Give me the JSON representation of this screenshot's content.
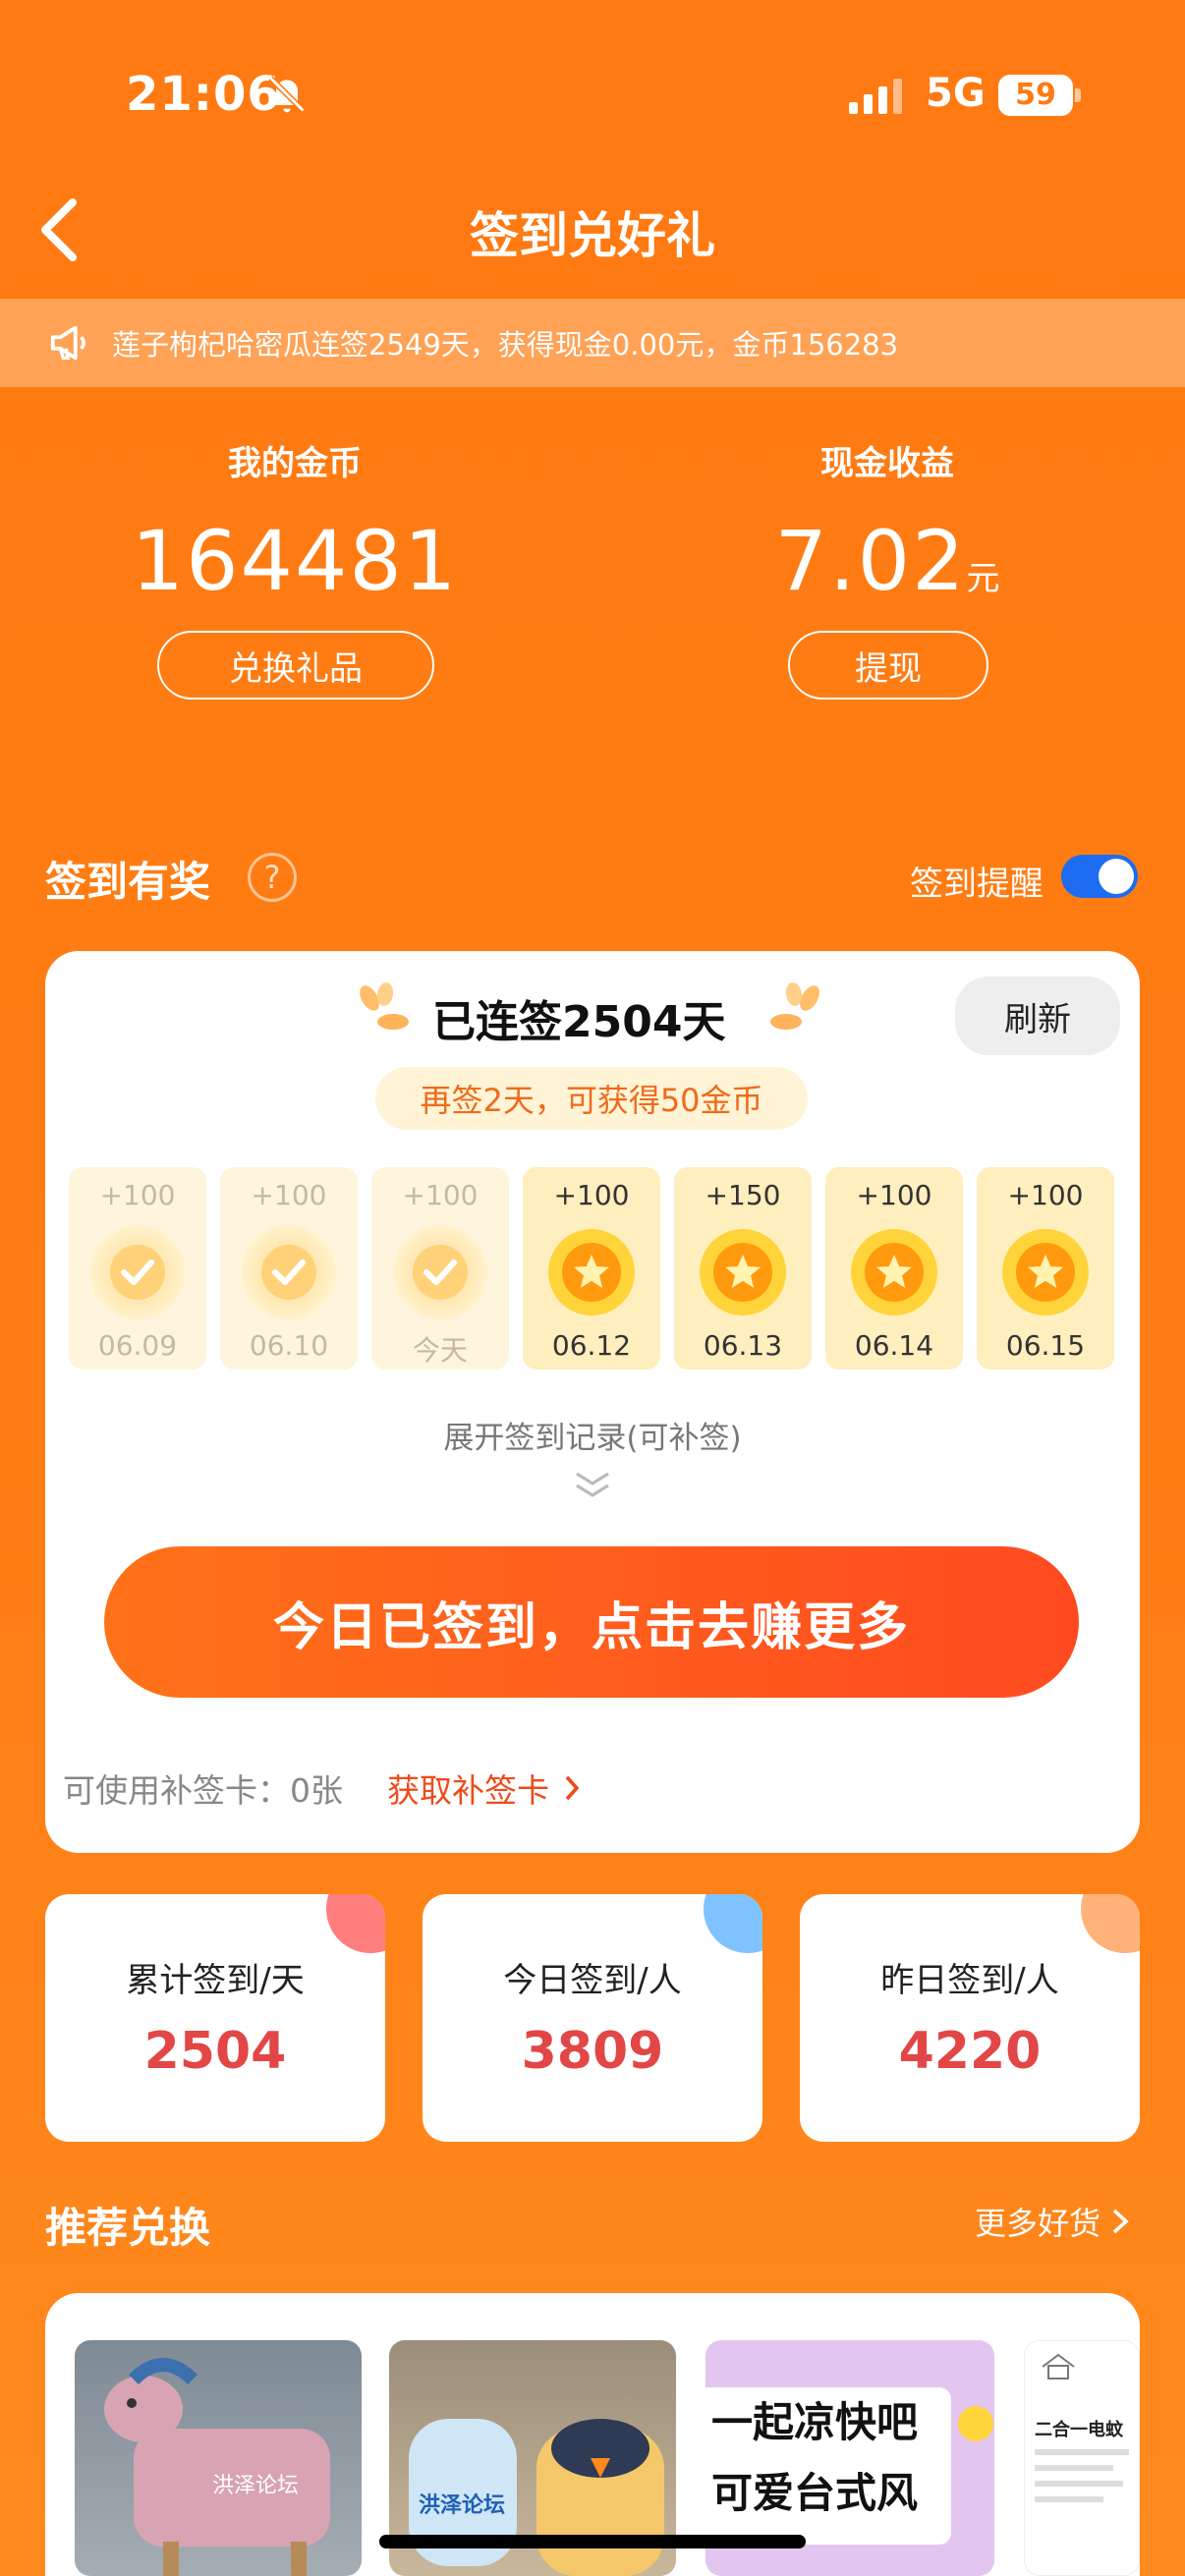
{
  "status_bar": {
    "time": "21:06",
    "network": "5G",
    "battery": "59"
  },
  "header": {
    "title": "签到兑好礼"
  },
  "notice": {
    "text": "莲子枸杞哈密瓜连签2549天，获得现金0.00元，金币156283"
  },
  "wallet": {
    "coins_label": "我的金币",
    "coins_value": "164481",
    "coins_button": "兑换礼品",
    "cash_label": "现金收益",
    "cash_value": "7.02",
    "cash_unit": "元",
    "cash_button": "提现"
  },
  "checkin_section": {
    "title": "签到有奖",
    "help": "?",
    "reminder_label": "签到提醒",
    "reminder_on": true
  },
  "checkin_card": {
    "streak": "已连签2504天",
    "refresh": "刷新",
    "hint": "再签2天，可获得50金币",
    "days": [
      {
        "points": "+100",
        "date": "06.09",
        "state": "done"
      },
      {
        "points": "+100",
        "date": "06.10",
        "state": "done"
      },
      {
        "points": "+100",
        "date": "今天",
        "state": "done"
      },
      {
        "points": "+100",
        "date": "06.12",
        "state": "upcoming"
      },
      {
        "points": "+150",
        "date": "06.13",
        "state": "upcoming"
      },
      {
        "points": "+100",
        "date": "06.14",
        "state": "upcoming"
      },
      {
        "points": "+100",
        "date": "06.15",
        "state": "upcoming"
      }
    ],
    "expand": "展开签到记录(可补签)",
    "cta": "今日已签到，点击去赚更多",
    "makeup_label": "可使用补签卡：0张",
    "makeup_link": "获取补签卡"
  },
  "stats": [
    {
      "label": "累计签到/天",
      "value": "2504",
      "accent": "#ff7f7f"
    },
    {
      "label": "今日签到/人",
      "value": "3809",
      "accent": "#7ec3ff"
    },
    {
      "label": "昨日签到/人",
      "value": "4220",
      "accent": "#ffb27a"
    }
  ],
  "recommend": {
    "title": "推荐兑换",
    "more": "更多好货",
    "products": [
      {
        "caption": "洪泽论坛"
      },
      {
        "caption": "洪泽论坛"
      },
      {
        "caption": "一起凉快吧 可爱台式风扇"
      },
      {
        "caption": "二合一电蚊"
      }
    ]
  },
  "colors": {
    "brand": "#ff7a12",
    "accent_red": "#e24646",
    "toggle_blue": "#1d6cf2"
  }
}
